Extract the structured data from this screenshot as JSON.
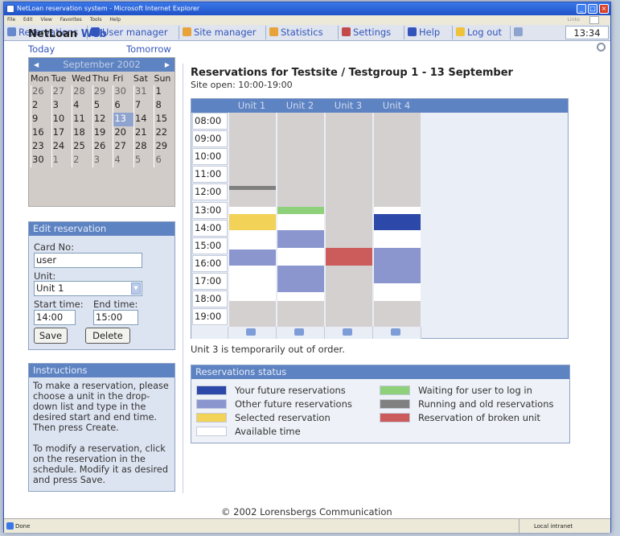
{
  "window": {
    "title": "NetLoan reservation system - Microsoft Internet Explorer",
    "menu": [
      "File",
      "Edit",
      "View",
      "Favorites",
      "Tools",
      "Help"
    ],
    "links_label": "Links"
  },
  "nav": {
    "items": [
      {
        "label": "Reservations",
        "icon": "calendar-icon",
        "color": "#6688cc"
      },
      {
        "label": "User manager",
        "icon": "users-icon",
        "color": "#3355bb"
      },
      {
        "label": "Site manager",
        "icon": "site-icon",
        "color": "#e8a23a"
      },
      {
        "label": "Statistics",
        "icon": "chart-icon",
        "color": "#e8a23a"
      },
      {
        "label": "Settings",
        "icon": "settings-icon",
        "color": "#c24a4a"
      },
      {
        "label": "Help",
        "icon": "help-icon",
        "color": "#3355bb"
      },
      {
        "label": "Log out",
        "icon": "logout-icon",
        "color": "#f0c23a"
      }
    ],
    "clock": "13:34"
  },
  "brand": {
    "name": "NetLoan",
    "suffix": "Web"
  },
  "links": {
    "today": "Today",
    "tomorrow": "Tomorrow"
  },
  "calendar": {
    "month": "September 2002",
    "dow": [
      "Mon",
      "Tue",
      "Wed",
      "Thu",
      "Fri",
      "Sat",
      "Sun"
    ],
    "weeks": [
      [
        "26",
        "27",
        "28",
        "29",
        "30",
        "31",
        "1"
      ],
      [
        "2",
        "3",
        "4",
        "5",
        "6",
        "7",
        "8"
      ],
      [
        "9",
        "10",
        "11",
        "12",
        "13",
        "14",
        "15"
      ],
      [
        "16",
        "17",
        "18",
        "19",
        "20",
        "21",
        "22"
      ],
      [
        "23",
        "24",
        "25",
        "26",
        "27",
        "28",
        "29"
      ],
      [
        "30",
        "1",
        "2",
        "3",
        "4",
        "5",
        "6"
      ]
    ],
    "selected": "13"
  },
  "edit": {
    "title": "Edit reservation",
    "card_label": "Card No:",
    "card_value": "user",
    "unit_label": "Unit:",
    "unit_value": "Unit 1",
    "start_label": "Start time:",
    "end_label": "End time:",
    "start_value": "14:00",
    "end_value": "15:00",
    "save": "Save",
    "delete": "Delete"
  },
  "instructions": {
    "title": "Instructions",
    "p1": "To make a reservation, please choose a unit in the drop-down list and type in the desired start and end time. Then press Create.",
    "p2": "To modify a reservation, click on the reservation in the schedule. Modify it as desired and press Save."
  },
  "main": {
    "title": "Reservations for Testsite / Testgroup 1 - 13 September",
    "site_open": "Site open: 10:00-19:00",
    "note": "Unit 3 is temporarily out of order.",
    "copyright": "© 2002 Lorensbergs Communication"
  },
  "schedule": {
    "units": [
      "Unit 1",
      "Unit 2",
      "Unit 3",
      "Unit 4"
    ],
    "times": [
      "08:00",
      "09:00",
      "10:00",
      "11:00",
      "12:00",
      "13:00",
      "14:00",
      "15:00",
      "16:00",
      "17:00",
      "18:00",
      "19:00"
    ],
    "day_start_hour": 8,
    "day_end_hour": 20,
    "colors": {
      "closed": "#d4d0cf",
      "available": "#ffffff",
      "mine": "#2c48a8",
      "other": "#8b96cf",
      "selected": "#f2d257",
      "waiting": "#8fd07a",
      "running": "#808080",
      "broken": "#cc5c5c"
    },
    "columns": [
      [
        {
          "start": 12.1,
          "end": 12.35,
          "type": "running"
        },
        {
          "start": 13.3,
          "end": 13.7,
          "type": "available"
        },
        {
          "start": 13.7,
          "end": 14.6,
          "type": "selected"
        },
        {
          "start": 14.6,
          "end": 15.7,
          "type": "available"
        },
        {
          "start": 15.7,
          "end": 16.6,
          "type": "other"
        },
        {
          "start": 16.6,
          "end": 18.6,
          "type": "available"
        },
        {
          "start": 18.6,
          "end": 19.0,
          "type": "closed"
        }
      ],
      [
        {
          "start": 13.3,
          "end": 13.7,
          "type": "waiting"
        },
        {
          "start": 13.7,
          "end": 14.6,
          "type": "available"
        },
        {
          "start": 14.6,
          "end": 15.6,
          "type": "other"
        },
        {
          "start": 15.6,
          "end": 16.6,
          "type": "available"
        },
        {
          "start": 16.6,
          "end": 18.1,
          "type": "other"
        },
        {
          "start": 18.1,
          "end": 18.6,
          "type": "available"
        },
        {
          "start": 18.6,
          "end": 19.0,
          "type": "closed"
        }
      ],
      [
        {
          "start": 15.6,
          "end": 16.6,
          "type": "broken"
        }
      ],
      [
        {
          "start": 13.3,
          "end": 13.7,
          "type": "available"
        },
        {
          "start": 13.7,
          "end": 14.6,
          "type": "mine"
        },
        {
          "start": 14.6,
          "end": 15.6,
          "type": "available"
        },
        {
          "start": 15.6,
          "end": 17.6,
          "type": "other"
        },
        {
          "start": 17.6,
          "end": 18.6,
          "type": "available"
        },
        {
          "start": 18.6,
          "end": 19.0,
          "type": "closed"
        }
      ]
    ]
  },
  "status": {
    "title": "Reservations status",
    "legend": [
      {
        "label": "Your future reservations",
        "type": "mine"
      },
      {
        "label": "Other future reservations",
        "type": "other"
      },
      {
        "label": "Selected reservation",
        "type": "selected"
      },
      {
        "label": "Available time",
        "type": "available"
      },
      {
        "label": "Waiting for user to log in",
        "type": "waiting"
      },
      {
        "label": "Running and old reservations",
        "type": "running"
      },
      {
        "label": "Reservation of broken unit",
        "type": "broken"
      }
    ]
  },
  "statusbar": {
    "done": "Done",
    "zone": "Local intranet"
  }
}
